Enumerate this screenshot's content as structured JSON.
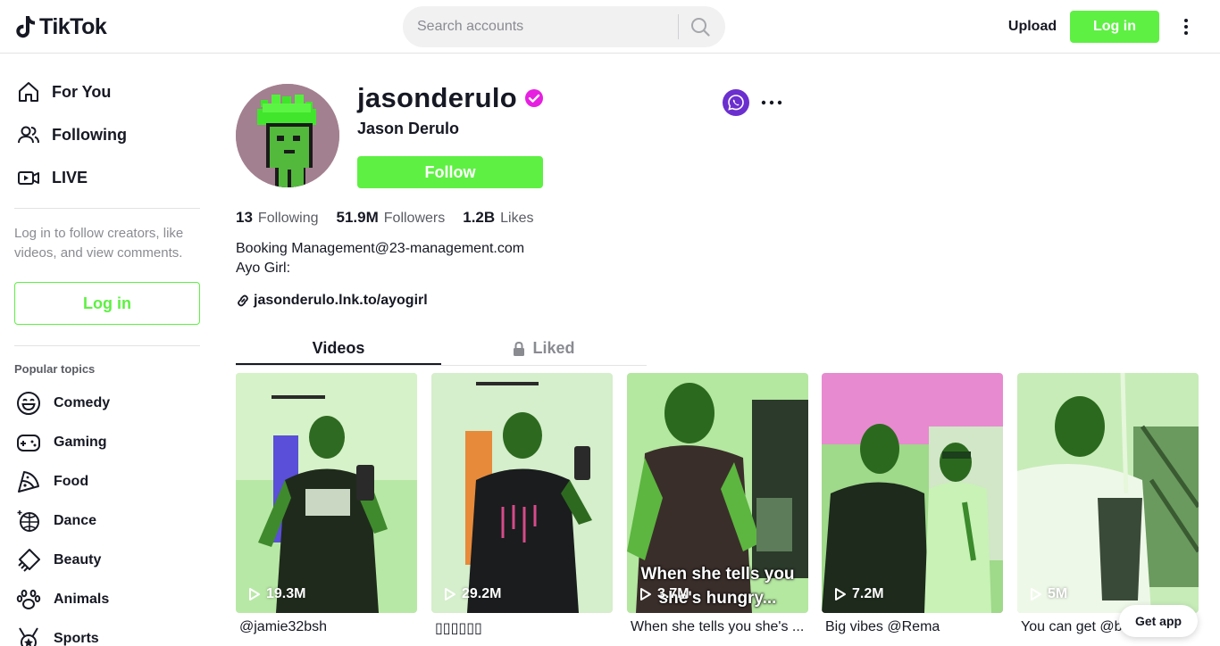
{
  "header": {
    "logo_text": "TikTok",
    "search_placeholder": "Search accounts",
    "upload_label": "Upload",
    "login_label": "Log in"
  },
  "sidebar": {
    "nav": [
      {
        "label": "For You",
        "icon": "home-icon"
      },
      {
        "label": "Following",
        "icon": "users-icon"
      },
      {
        "label": "LIVE",
        "icon": "live-camera-icon"
      }
    ],
    "login_hint": "Log in to follow creators, like videos, and view comments.",
    "login_button": "Log in",
    "popular_title": "Popular topics",
    "topics": [
      {
        "label": "Comedy",
        "icon": "smile-icon"
      },
      {
        "label": "Gaming",
        "icon": "gamepad-icon"
      },
      {
        "label": "Food",
        "icon": "pizza-icon"
      },
      {
        "label": "Dance",
        "icon": "disco-ball-icon"
      },
      {
        "label": "Beauty",
        "icon": "comb-icon"
      },
      {
        "label": "Animals",
        "icon": "paw-icon"
      },
      {
        "label": "Sports",
        "icon": "medal-icon"
      }
    ]
  },
  "profile": {
    "username": "jasonderulo",
    "display_name": "Jason Derulo",
    "follow_label": "Follow",
    "stats": {
      "following_count": "13",
      "following_label": "Following",
      "followers_count": "51.9M",
      "followers_label": "Followers",
      "likes_count": "1.2B",
      "likes_label": "Likes"
    },
    "bio_line1": "Booking Management@23-management.com",
    "bio_line2": "Ayo Girl:",
    "link": "jasonderulo.lnk.to/ayogirl"
  },
  "tabs": {
    "videos": "Videos",
    "liked": "Liked"
  },
  "videos": [
    {
      "views": "19.3M",
      "caption": "@jamie32bsh"
    },
    {
      "views": "29.2M",
      "caption": "▯▯▯▯▯▯"
    },
    {
      "views": "3.7M",
      "caption": "When she tells you she's ...",
      "overlay_line1": "When she tells you",
      "overlay_line2": "she's hungry..."
    },
    {
      "views": "7.2M",
      "caption": "Big vibes @Rema"
    },
    {
      "views": "5M",
      "caption": "You can get @bo..."
    }
  ],
  "get_app": "Get app",
  "colors": {
    "accent": "#5ef043",
    "share_purple": "#6b2fcf",
    "verified": "#e61fe1"
  }
}
